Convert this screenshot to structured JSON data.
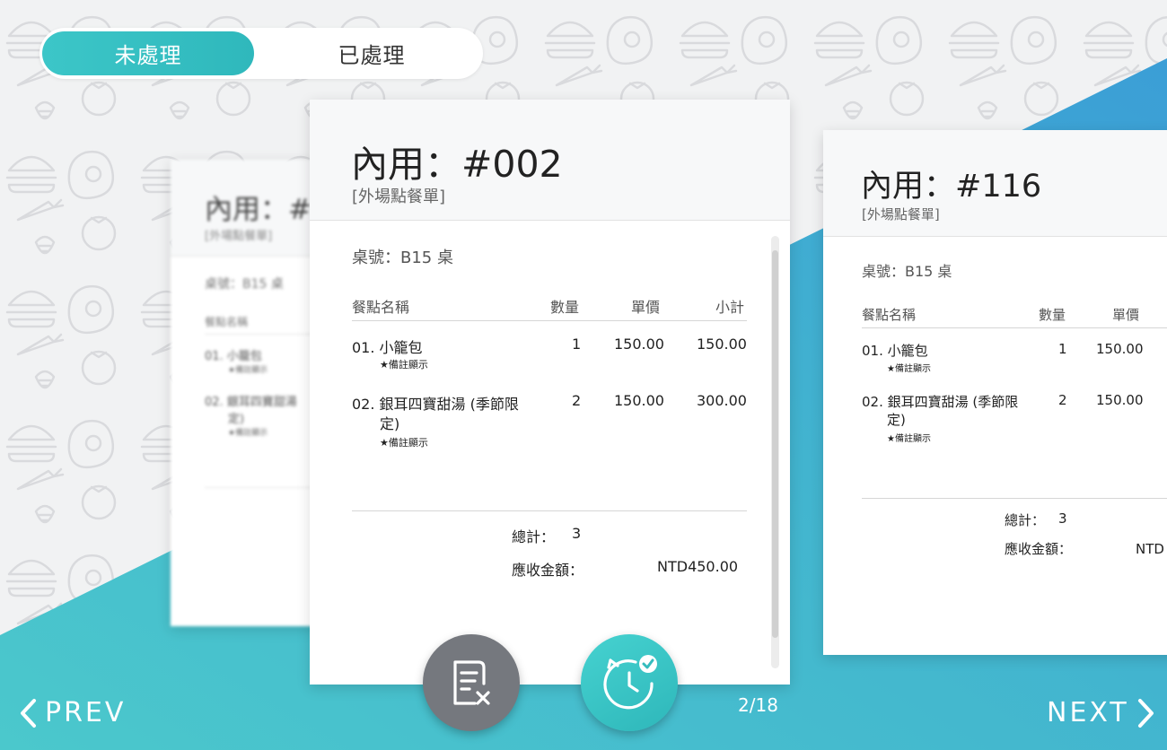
{
  "tabs": {
    "unprocessed": "未處理",
    "processed": "已處理"
  },
  "orders": {
    "center": {
      "title": "內用：#002",
      "subtitle": "[外場點餐單]",
      "table_no": "桌號：B15 桌",
      "headers": {
        "name": "餐點名稱",
        "qty": "數量",
        "price": "單價",
        "subtotal": "小計"
      },
      "items": [
        {
          "name": "01. 小籠包",
          "name2": "",
          "note": "★備註顯示",
          "qty": "1",
          "price": "150.00",
          "subtotal": "150.00"
        },
        {
          "name": "02. 銀耳四寶甜湯 (季節限",
          "name2": "定)",
          "note": "★備註顯示",
          "qty": "2",
          "price": "150.00",
          "subtotal": "300.00"
        }
      ],
      "total_label": "總計：",
      "total_qty": "3",
      "amount_label": "應收金額：",
      "amount_value": "NTD450.00"
    },
    "right": {
      "title": "內用：#116",
      "subtitle": "[外場點餐單]",
      "table_no": "桌號：B15 桌",
      "headers": {
        "name": "餐點名稱",
        "qty": "數量",
        "price": "單價"
      },
      "items": [
        {
          "name": "01. 小籠包",
          "name2": "",
          "note": "★備註顯示",
          "qty": "1",
          "price": "150.00"
        },
        {
          "name": "02. 銀耳四寶甜湯 (季節限",
          "name2": "定)",
          "note": "★備註顯示",
          "qty": "2",
          "price": "150.00"
        }
      ],
      "total_label": "總計：",
      "total_qty": "3",
      "amount_label": "應收金額：",
      "amount_value": "NTD"
    },
    "left": {
      "title": "內用：#",
      "subtitle": "[外場點餐單]",
      "table_no": "桌號：B15 桌",
      "header_name": "餐點名稱",
      "items": [
        {
          "name": "01. 小籠包",
          "note": "★備註顯示"
        },
        {
          "name": "02. 銀耳四寶甜湯",
          "name2": "定)",
          "note": "★備註顯示"
        }
      ]
    }
  },
  "nav": {
    "prev": "PREV",
    "next": "NEXT",
    "page": "2/18"
  },
  "colors": {
    "accent": "#3cc6c8",
    "wave_start": "#4bc8cc",
    "wave_end": "#3b9ed6",
    "cancel_button": "#75787e"
  },
  "icons": {
    "cancel": "receipt-x-icon",
    "process": "timer-check-icon",
    "prev": "chevron-left-icon",
    "next": "chevron-right-icon"
  }
}
